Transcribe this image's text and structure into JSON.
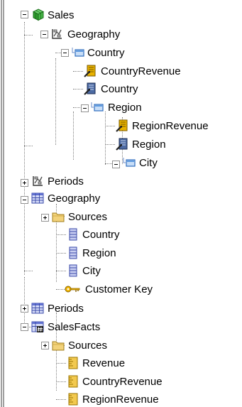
{
  "tree": {
    "nodes": [
      {
        "id": "sales",
        "label": "Sales",
        "icon": "cube-icon"
      },
      {
        "id": "geo-dim",
        "label": "Geography",
        "icon": "hierarchy-icon"
      },
      {
        "id": "country-level",
        "label": "Country",
        "icon": "level-icon"
      },
      {
        "id": "country-revenue-attr",
        "label": "CountryRevenue",
        "icon": "attribute-icon"
      },
      {
        "id": "country-attr",
        "label": "Country",
        "icon": "attribute-icon"
      },
      {
        "id": "region-level",
        "label": "Region",
        "icon": "level-icon"
      },
      {
        "id": "region-revenue-attr",
        "label": "RegionRevenue",
        "icon": "attribute-icon"
      },
      {
        "id": "region-attr",
        "label": "Region",
        "icon": "attribute-icon"
      },
      {
        "id": "city-level",
        "label": "City",
        "icon": "level-icon"
      },
      {
        "id": "periods-dim",
        "label": "Periods",
        "icon": "hierarchy-icon"
      },
      {
        "id": "geo-table",
        "label": "Geography",
        "icon": "table-icon"
      },
      {
        "id": "geo-sources",
        "label": "Sources",
        "icon": "folder-icon"
      },
      {
        "id": "geo-country-col",
        "label": "Country",
        "icon": "column-icon"
      },
      {
        "id": "geo-region-col",
        "label": "Region",
        "icon": "column-icon"
      },
      {
        "id": "geo-city-col",
        "label": "City",
        "icon": "column-icon"
      },
      {
        "id": "customer-key",
        "label": "Customer Key",
        "icon": "key-icon"
      },
      {
        "id": "periods-table",
        "label": "Periods",
        "icon": "table-icon"
      },
      {
        "id": "salesfacts",
        "label": "SalesFacts",
        "icon": "fact-table-icon"
      },
      {
        "id": "facts-sources",
        "label": "Sources",
        "icon": "folder-icon"
      },
      {
        "id": "revenue-measure",
        "label": "Revenue",
        "icon": "measure-icon"
      },
      {
        "id": "country-revenue-measure",
        "label": "CountryRevenue",
        "icon": "measure-icon"
      },
      {
        "id": "region-revenue-measure",
        "label": "RegionRevenue",
        "icon": "measure-icon"
      }
    ]
  }
}
